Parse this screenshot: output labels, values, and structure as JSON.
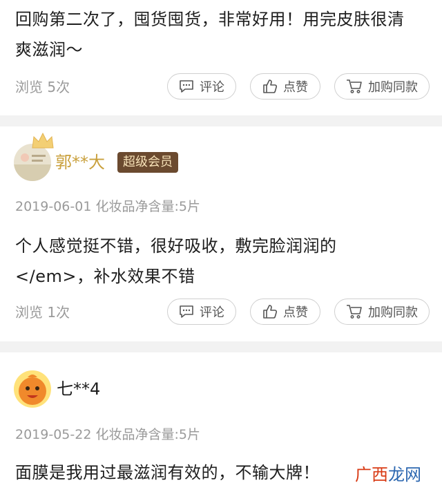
{
  "review1": {
    "text": "回购第二次了，囤货囤货，非常好用！用完皮肤很清爽滋润～",
    "views": "浏览 5次"
  },
  "actions": {
    "comment": "评论",
    "like": "点赞",
    "cart": "加购同款"
  },
  "review2": {
    "username": "郭**大",
    "badge": "超级会员",
    "date": "2019-06-01",
    "spec": "化妆品净含量:5片",
    "text": "个人感觉挺不错，很好吸收，敷完脸润润的</em>，补水效果不错",
    "views": "浏览 1次"
  },
  "review3": {
    "username": "七**4",
    "date": "2019-05-22",
    "spec": "化妆品净含量:5片",
    "text": "面膜是我用过最滋润有效的，不输大牌！"
  },
  "watermark": {
    "part1": "广西",
    "part2": "龙网"
  },
  "colors": {
    "badge_bg": "#6b4a2f",
    "username_gold": "#c9a03c",
    "muted": "#9a9a9a",
    "divider": "#f2f2f2"
  }
}
